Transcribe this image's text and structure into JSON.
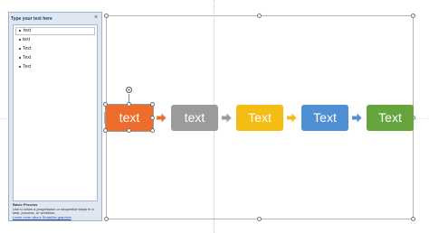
{
  "text_pane": {
    "header": "Type your text here",
    "close_glyph": "×",
    "items": [
      "text",
      "text",
      "Text",
      "Text",
      "Text"
    ],
    "footer_title": "Basic Process",
    "footer_description": "Use to show a progression or sequential steps in a task, process, or workflow.",
    "footer_link": "Learn more about SmartArt graphics"
  },
  "diagram": {
    "boxes": [
      {
        "label": "text",
        "color": "#ee6d2c"
      },
      {
        "label": "text",
        "color": "#9b9b9b"
      },
      {
        "label": "Text",
        "color": "#f4bd13"
      },
      {
        "label": "Text",
        "color": "#4f8fd3"
      },
      {
        "label": "Text",
        "color": "#66a53d"
      }
    ],
    "arrow_colors": [
      "#ee6d2c",
      "#9b9b9b",
      "#f4bd13",
      "#4f8fd3"
    ]
  }
}
